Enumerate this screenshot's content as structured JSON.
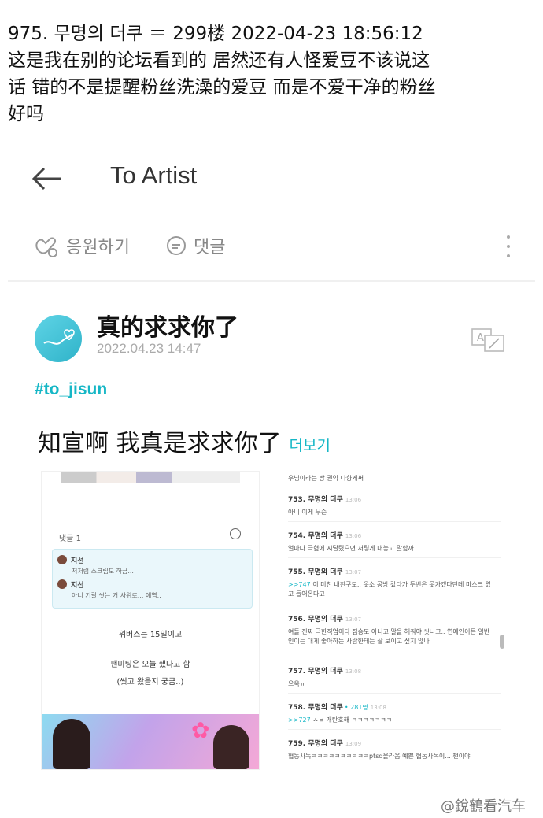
{
  "header": {
    "line1": "975. 무명의 더쿠 ＝ 299楼 2022-04-23 18:56:12",
    "line2": "这是我在别的论坛看到的 居然还有人怪爱豆不该说这",
    "line3": "话 错的不是提醒粉丝洗澡的爱豆 而是不爱干净的粉丝",
    "line4": "好吗"
  },
  "app": {
    "title": "To Artist",
    "cheer_label": "응원하기",
    "comment_label": "댓글"
  },
  "post": {
    "title": "真的求求你了",
    "date": "2022.04.23 14:47",
    "hashtag": "#to_jisun",
    "body": "知宣啊 我真是求求你了",
    "more": "더보기"
  },
  "left_panel": {
    "comment_count": "댓글 1",
    "c1_name": "지선",
    "c1_text": "저처럼 스크립도 하금...",
    "c2_name": "지선",
    "c2_text": "아니 기괄 씻는 거 사위로... 애엽..",
    "line_a": "위버스는 15일이고",
    "line_b": "팬미팅은 오늘 했다고 함",
    "line_c": "(씻고 왔을지 궁금..)"
  },
  "right_panel": {
    "top_text": "우님이라는 방 권익 나향게써",
    "items": [
      {
        "num": "753. 무명의 더쿠",
        "time": "13:06",
        "like": "",
        "text": "아니 이게 무슨",
        "tag": ""
      },
      {
        "num": "754. 무명의 더쿠",
        "time": "13:06",
        "like": "",
        "text": "얼마나 극혐에 시달렸으면 저렇게 대놓고 말함까...",
        "tag": ""
      },
      {
        "num": "755. 무명의 더쿠",
        "time": "13:07",
        "like": "",
        "text": "이 미친 내친구도.. 옷소 공방 갔다가 두번은 못가겠다던데 마스크 있고 들어온다고",
        "tag": ">>747"
      },
      {
        "num": "756. 무명의 더쿠",
        "time": "13:07",
        "like": "",
        "text": "여돌 진짜 극한직업이다 짐승도 아니고 말을 해줘야 씻나고.. 연예인이든 일반인이든 대게 좋아하는 사람한테는 잘 보이고 싶지 않나",
        "tag": ""
      },
      {
        "num": "757. 무명의 더쿠",
        "time": "13:08",
        "like": "",
        "text": "으욱ㅠ",
        "tag": ""
      },
      {
        "num": "758. 무명의 더쿠",
        "time": "13:08",
        "like": "• 281명",
        "text": "ㅅㅂ 개탄호해 ㅋㅋㅋㅋㅋㅋㅋ",
        "tag": ">>727"
      },
      {
        "num": "759. 무명의 더쿠",
        "time": "13:09",
        "like": "",
        "text": "협동사녹ㅋㅋㅋㅋㅋㅋㅋㅋㅋㅋptsd올라옴 예쁜 협동사녹이... 쩐이야",
        "tag": ""
      }
    ]
  },
  "watermark": "@銳鶴看汽车",
  "colors": {
    "accent": "#16b7c6",
    "muted": "#888888"
  },
  "icons": [
    "back-arrow-icon",
    "cheer-hand-icon",
    "comment-bubble-icon",
    "more-vertical-icon",
    "translate-icon",
    "refresh-icon"
  ]
}
